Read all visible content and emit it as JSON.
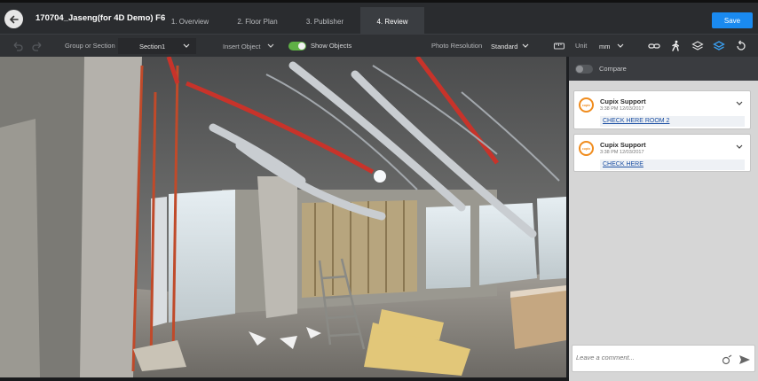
{
  "app": {
    "project_title": "170704_Jaseng(for 4D Demo) F6",
    "save_label": "Save"
  },
  "tabs": [
    {
      "label": "1. Overview",
      "active": false
    },
    {
      "label": "2. Floor Plan",
      "active": false
    },
    {
      "label": "3. Publisher",
      "active": false
    },
    {
      "label": "4. Review",
      "active": true
    }
  ],
  "toolbar": {
    "group_label": "Group or Section",
    "section_value": "Section1",
    "insert_object_label": "Insert Object",
    "show_objects_label": "Show Objects",
    "show_objects_on": true,
    "photo_resolution_label": "Photo Resolution",
    "photo_resolution_value": "Standard",
    "unit_label": "Unit",
    "unit_value": "mm",
    "icons": [
      "undo-icon",
      "redo-icon",
      "ruler-icon",
      "link-icon",
      "walk-icon",
      "layers-icon",
      "layers-active-icon",
      "reset-rotate-icon"
    ]
  },
  "panel": {
    "compare_label": "Compare",
    "compare_on": false,
    "comments": [
      {
        "author": "Cupix Support",
        "time": "3:38 PM 12/03/2017",
        "link": "CHECK HERE ROOM 2"
      },
      {
        "author": "Cupix Support",
        "time": "3:38 PM 12/03/2017",
        "link": "CHECK HERE"
      }
    ],
    "comment_placeholder": "Leave a comment..."
  },
  "colors": {
    "accent": "#1a8af0",
    "toggle_on": "#5fb045",
    "avatar_ring": "#f08c1e",
    "link": "#1b4fa3"
  }
}
